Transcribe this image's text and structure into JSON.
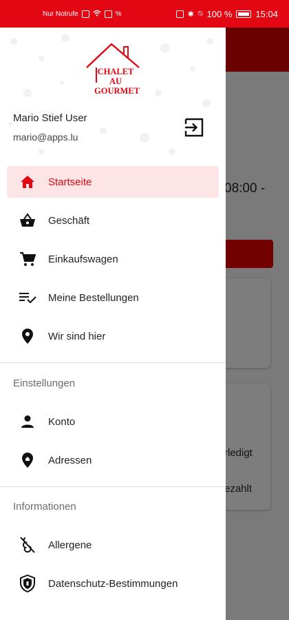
{
  "status_bar": {
    "carrier": "Nur Notrufe",
    "battery": "100 %",
    "time": "15:04"
  },
  "background": {
    "time_fragment": "08:00 -",
    "label_done": "rledigt",
    "label_paid": "ezahlt"
  },
  "drawer": {
    "logo": {
      "line1": "CHALET",
      "line2": "AU",
      "line3": "GOURMET"
    },
    "user": {
      "name": "Mario Stief User",
      "email": "mario@apps.lu"
    },
    "menu": [
      {
        "label": "Startseite",
        "icon": "home-icon"
      },
      {
        "label": "Geschäft",
        "icon": "basket-icon"
      },
      {
        "label": "Einkaufswagen",
        "icon": "cart-icon"
      },
      {
        "label": "Meine Bestellungen",
        "icon": "checklist-icon"
      },
      {
        "label": "Wir sind hier",
        "icon": "location-pin-icon"
      }
    ],
    "settings": {
      "title": "Einstellungen",
      "items": [
        {
          "label": "Konto",
          "icon": "person-icon"
        },
        {
          "label": "Adressen",
          "icon": "address-pin-icon"
        }
      ]
    },
    "info": {
      "title": "Informationen",
      "items": [
        {
          "label": "Allergene",
          "icon": "allergen-icon"
        },
        {
          "label": "Datenschutz-Bestimmungen",
          "icon": "shield-icon"
        }
      ]
    }
  },
  "colors": {
    "accent": "#e30613",
    "active_bg": "#fde4e5"
  }
}
